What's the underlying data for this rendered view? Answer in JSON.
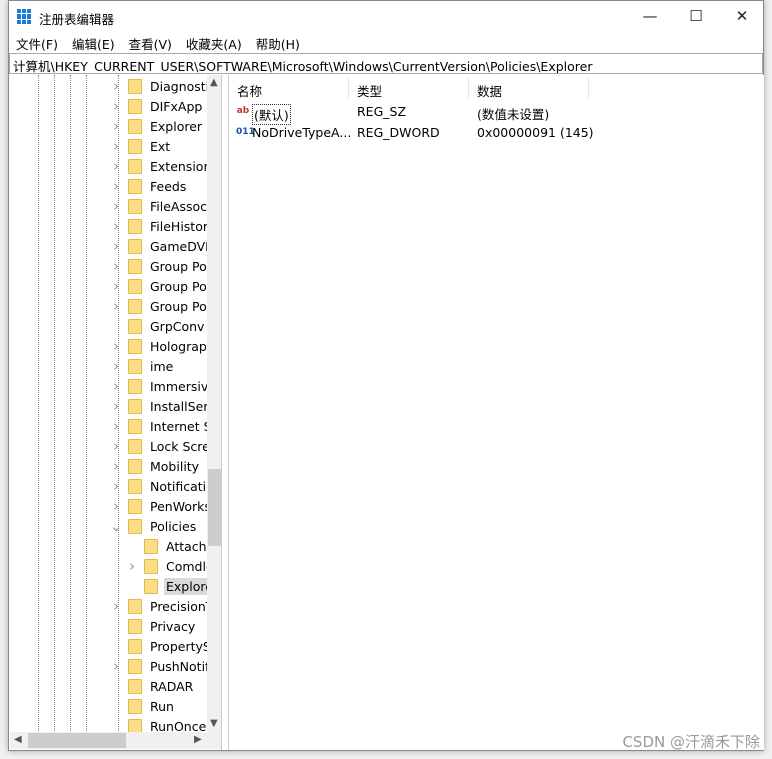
{
  "window": {
    "title": "注册表编辑器",
    "minimize": "—",
    "maximize": "☐",
    "close": "✕"
  },
  "menu": [
    "文件(F)",
    "编辑(E)",
    "查看(V)",
    "收藏夹(A)",
    "帮助(H)"
  ],
  "address": "计算机\\HKEY_CURRENT_USER\\SOFTWARE\\Microsoft\\Windows\\CurrentVersion\\Policies\\Explorer",
  "tree": [
    {
      "label": "Diagnostic",
      "level": 0,
      "chevron": "right"
    },
    {
      "label": "DIFxApp",
      "level": 0,
      "chevron": "right"
    },
    {
      "label": "Explorer",
      "level": 0,
      "chevron": "right"
    },
    {
      "label": "Ext",
      "level": 0,
      "chevron": "right"
    },
    {
      "label": "Extensions",
      "level": 0,
      "chevron": "right"
    },
    {
      "label": "Feeds",
      "level": 0,
      "chevron": "right"
    },
    {
      "label": "FileAssocia",
      "level": 0,
      "chevron": "right"
    },
    {
      "label": "FileHistory",
      "level": 0,
      "chevron": "right"
    },
    {
      "label": "GameDVR",
      "level": 0,
      "chevron": "right"
    },
    {
      "label": "Group Pol",
      "level": 0,
      "chevron": "right"
    },
    {
      "label": "Group Pol",
      "level": 0,
      "chevron": "right"
    },
    {
      "label": "Group Pol",
      "level": 0,
      "chevron": "right"
    },
    {
      "label": "GrpConv",
      "level": 0,
      "chevron": "none"
    },
    {
      "label": "Holograph",
      "level": 0,
      "chevron": "right"
    },
    {
      "label": "ime",
      "level": 0,
      "chevron": "right"
    },
    {
      "label": "Immersive",
      "level": 0,
      "chevron": "right"
    },
    {
      "label": "InstallServ",
      "level": 0,
      "chevron": "right"
    },
    {
      "label": "Internet Se",
      "level": 0,
      "chevron": "right"
    },
    {
      "label": "Lock Scree",
      "level": 0,
      "chevron": "right"
    },
    {
      "label": "Mobility",
      "level": 0,
      "chevron": "right"
    },
    {
      "label": "Notificatio",
      "level": 0,
      "chevron": "right"
    },
    {
      "label": "PenWorks",
      "level": 0,
      "chevron": "right"
    },
    {
      "label": "Policies",
      "level": 0,
      "chevron": "down"
    },
    {
      "label": "Attachm",
      "level": 1,
      "chevron": "none"
    },
    {
      "label": "Comdlg",
      "level": 1,
      "chevron": "right"
    },
    {
      "label": "Explore",
      "level": 1,
      "chevron": "none",
      "selected": true
    },
    {
      "label": "PrecisionT",
      "level": 0,
      "chevron": "right"
    },
    {
      "label": "Privacy",
      "level": 0,
      "chevron": "none"
    },
    {
      "label": "PropertySy",
      "level": 0,
      "chevron": "none"
    },
    {
      "label": "PushNotifi",
      "level": 0,
      "chevron": "right"
    },
    {
      "label": "RADAR",
      "level": 0,
      "chevron": "none"
    },
    {
      "label": "Run",
      "level": 0,
      "chevron": "none"
    },
    {
      "label": "RunOnce",
      "level": 0,
      "chevron": "none"
    }
  ],
  "columns": {
    "name": "名称",
    "type": "类型",
    "data": "数据"
  },
  "values": [
    {
      "icon": "string-value-icon",
      "icon_text": "ab",
      "name": "(默认)",
      "type": "REG_SZ",
      "data": "(数值未设置)"
    },
    {
      "icon": "dword-value-icon",
      "icon_text": "011",
      "name": "NoDriveTypeA...",
      "type": "REG_DWORD",
      "data": "0x00000091 (145)"
    }
  ],
  "watermark": "CSDN @汗滴禾下除"
}
